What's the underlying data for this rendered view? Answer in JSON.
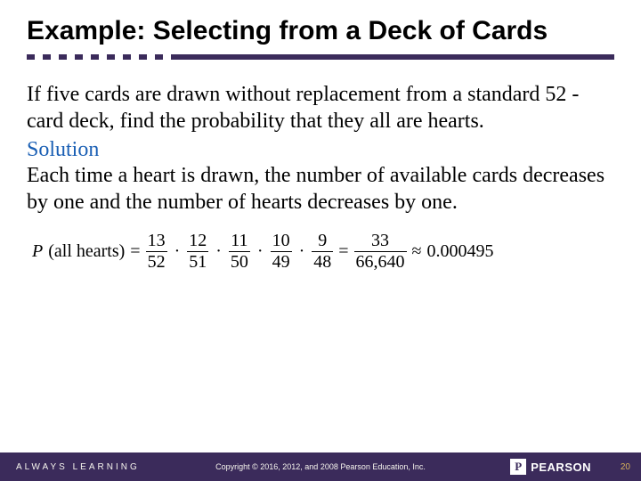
{
  "title": "Example: Selecting from a Deck of Cards",
  "problem_text": "If five cards are drawn without replacement from a standard 52 -card deck, find the probability that they all are hearts.",
  "solution_label": "Solution",
  "solution_text": "Each time a heart is drawn, the number of available cards decreases by one and the number of hearts decreases by one.",
  "equation": {
    "label": "P",
    "arg": "(all hearts)",
    "eq": "=",
    "fractions": [
      {
        "num": "13",
        "den": "52"
      },
      {
        "num": "12",
        "den": "51"
      },
      {
        "num": "11",
        "den": "50"
      },
      {
        "num": "10",
        "den": "49"
      },
      {
        "num": "9",
        "den": "48"
      }
    ],
    "dot": "·",
    "eq2": "=",
    "result_frac": {
      "num": "33",
      "den": "66,640"
    },
    "approx": "≈",
    "approx_val": "0.000495"
  },
  "footer": {
    "left": "ALWAYS LEARNING",
    "center": "Copyright © 2016, 2012, and 2008 Pearson Education, Inc.",
    "logo_badge": "P",
    "logo_text": "PEARSON",
    "page": "20"
  }
}
